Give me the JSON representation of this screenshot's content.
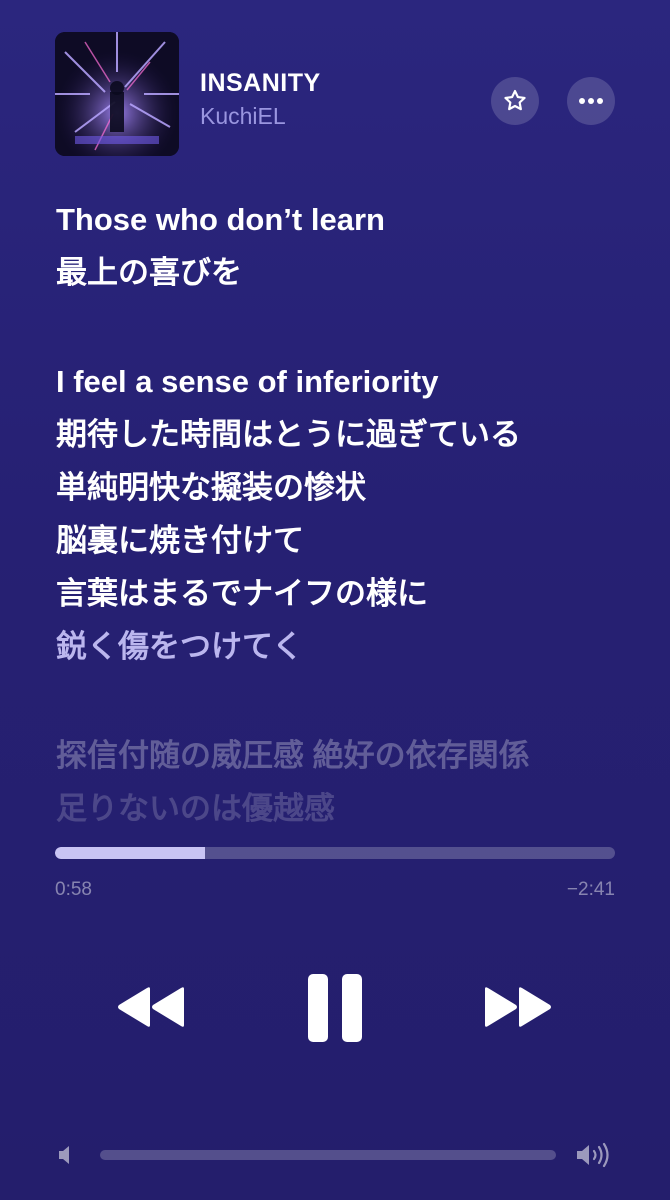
{
  "now_playing": {
    "title": "INSANITY",
    "artist": "KuchiEL",
    "artwork_icon": "album-artwork"
  },
  "header_actions": {
    "favorite_icon": "star-icon",
    "more_icon": "ellipsis-icon"
  },
  "lyrics": [
    {
      "text": "Those who don’t learn",
      "state": "current"
    },
    {
      "text": "最上の喜びを",
      "state": "current"
    },
    {
      "text": "",
      "state": "gap"
    },
    {
      "text": "I feel a sense of inferiority",
      "state": "current"
    },
    {
      "text": "期待した時間はとうに過ぎている",
      "state": "current"
    },
    {
      "text": "単純明快な擬装の惨状",
      "state": "current"
    },
    {
      "text": "脳裏に焼き付けて",
      "state": "current"
    },
    {
      "text": "言葉はまるでナイフの様に",
      "state": "current"
    },
    {
      "text": "鋭く傷をつけてく",
      "state": "dim1"
    },
    {
      "text": "",
      "state": "gap"
    },
    {
      "text": "探信付随の威圧感 絶好の依存関係",
      "state": "dim2"
    },
    {
      "text": "足りないのは優越感",
      "state": "dim3"
    }
  ],
  "playback": {
    "elapsed": "0:58",
    "remaining": "−2:41",
    "progress_fraction": 0.268
  },
  "controls": {
    "rewind_icon": "rewind-icon",
    "pause_icon": "pause-icon",
    "forward_icon": "fast-forward-icon"
  },
  "volume": {
    "level_fraction": 0.0,
    "min_icon": "speaker-low-icon",
    "max_icon": "speaker-high-icon"
  },
  "colors": {
    "background": "#2b267e",
    "artist_text": "#9a96e0",
    "progress_fill": "#c9c4f4"
  }
}
